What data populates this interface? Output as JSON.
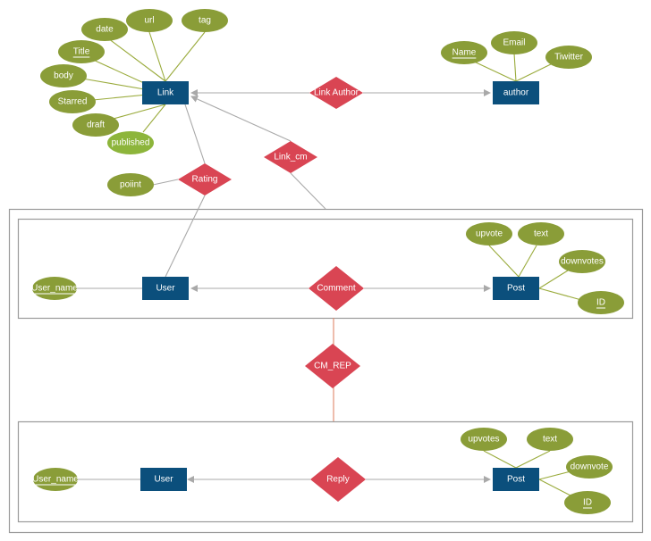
{
  "colors": {
    "entity": "#0b4f7c",
    "relationship": "#d94553",
    "attribute": "#8a9d38",
    "attribute_light": "#8db53b",
    "attribute_line": "#9aab3c",
    "relation_line": "#a9a9a9",
    "box_border": "#9a9a9a",
    "cm_rep_line": "#e0876a"
  },
  "entities": {
    "link": "Link",
    "author": "author",
    "user_comment": "User",
    "post_comment": "Post",
    "user_reply": "User",
    "post_reply": "Post"
  },
  "relationships": {
    "link_author": "Link Author",
    "link_cm": "Link_cm",
    "rating": "Rating",
    "comment": "Comment",
    "cm_rep": "CM_REP",
    "reply": "Reply"
  },
  "attributes": {
    "link": {
      "date": "date",
      "url": "url",
      "tag": "tag",
      "title": "Title",
      "body": "body",
      "starred": "Starred",
      "draft": "draft",
      "published": "published"
    },
    "rating": {
      "point": "poiint"
    },
    "author": {
      "name": "Name",
      "email": "Email",
      "twitter": "Tiwitter"
    },
    "user_comment": {
      "user_name": "User_name"
    },
    "post_comment": {
      "upvote": "upvote",
      "text": "text",
      "downvotes": "downvotes",
      "id": "ID"
    },
    "user_reply": {
      "user_name": "User_name"
    },
    "post_reply": {
      "upvotes": "upvotes",
      "text": "text",
      "downvote": "downvote",
      "id": "ID"
    }
  }
}
